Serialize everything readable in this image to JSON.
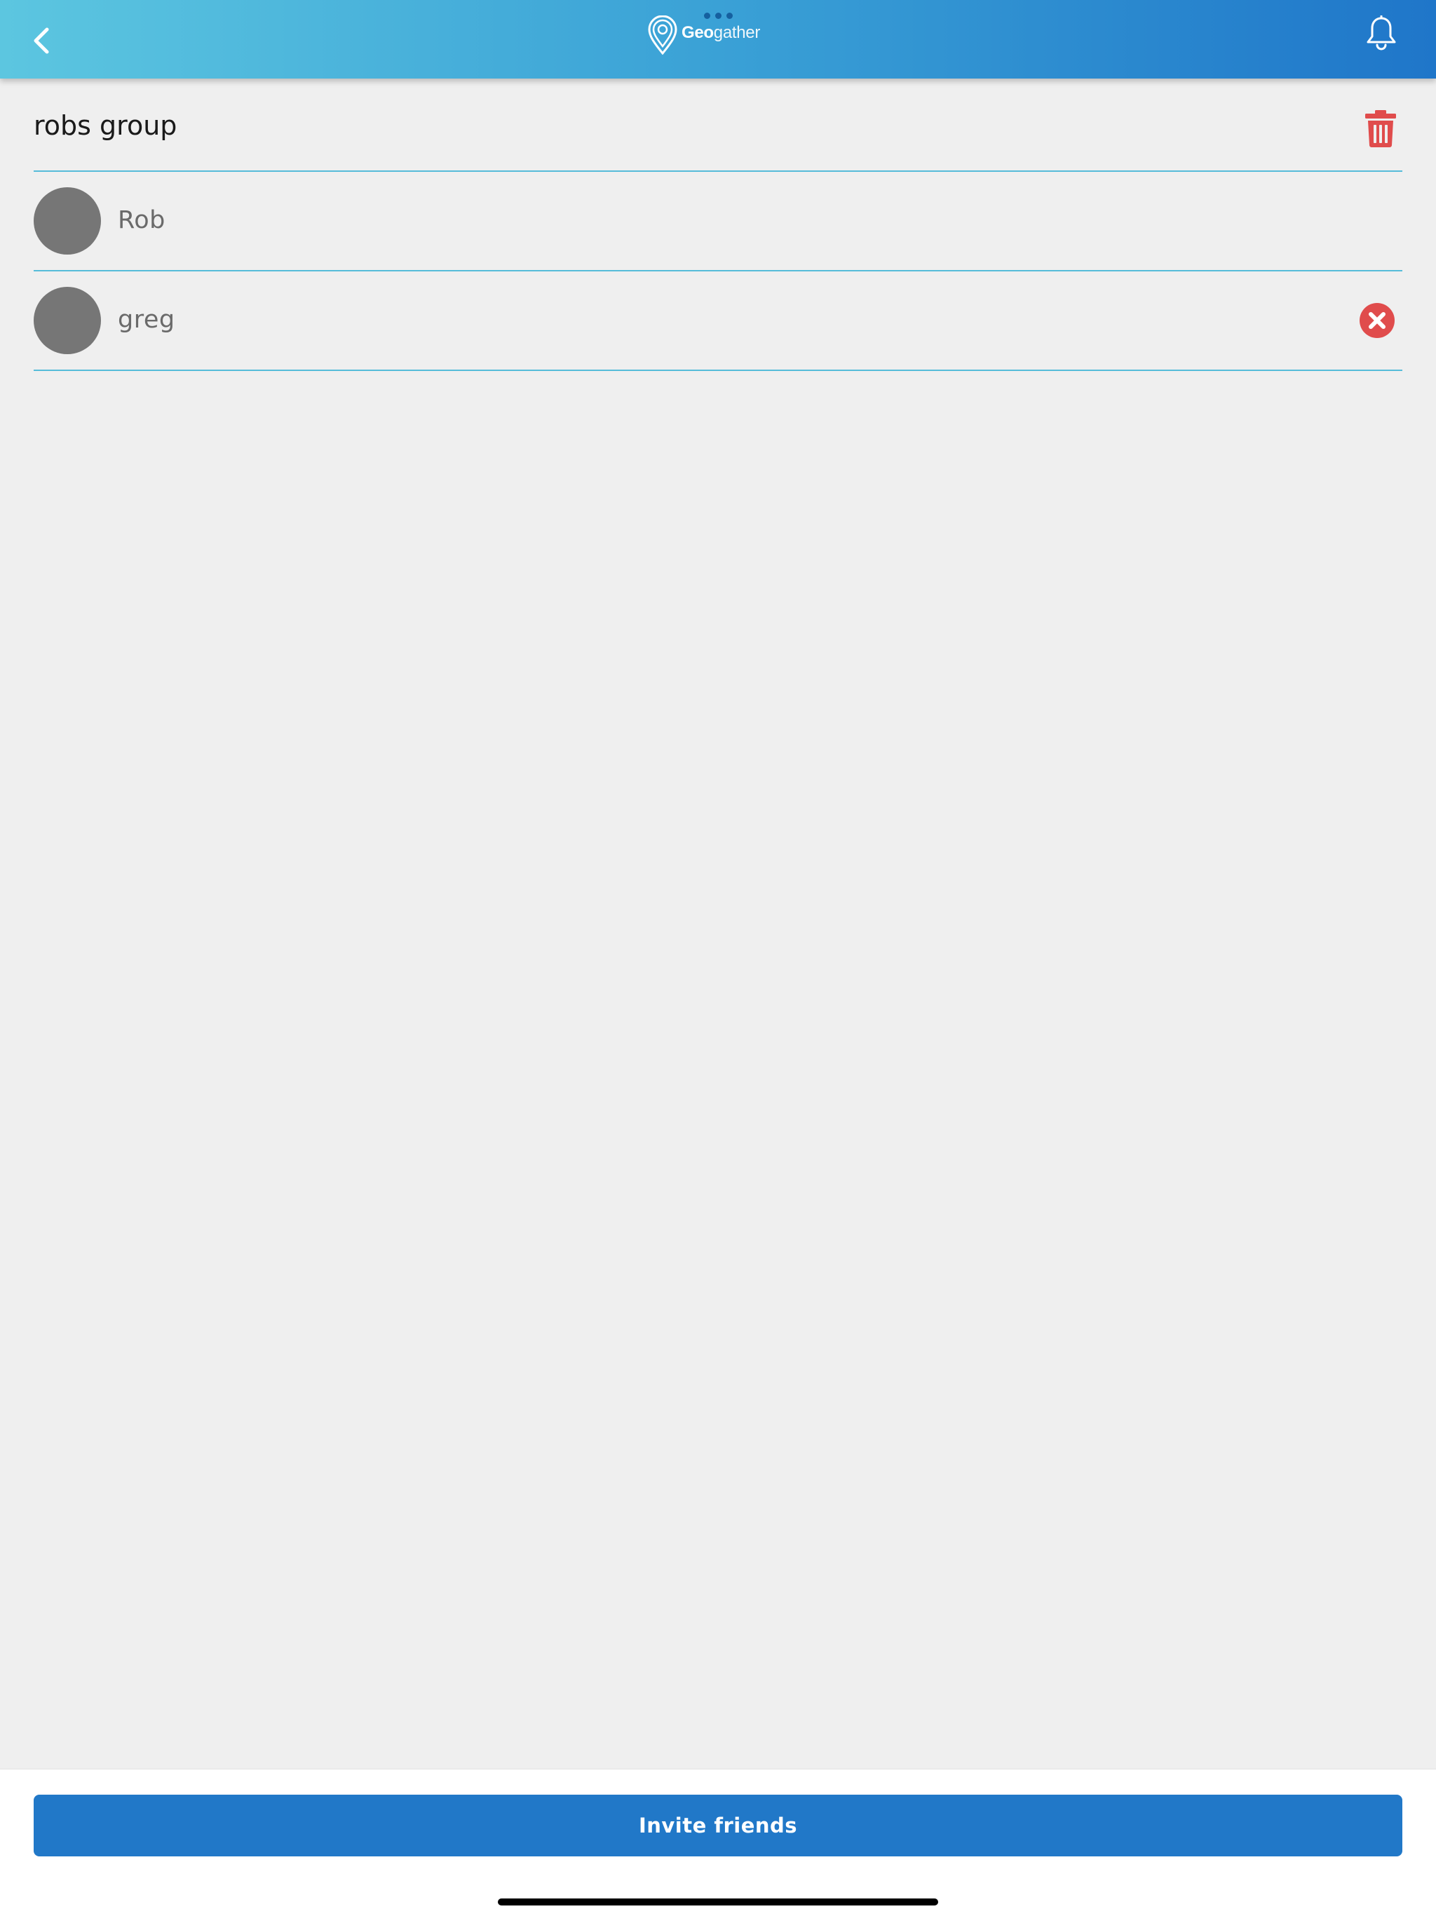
{
  "app": {
    "name_bold": "Geo",
    "name_light": "gather"
  },
  "group": {
    "name": "robs group"
  },
  "members": [
    {
      "name": "Rob",
      "removable": false
    },
    {
      "name": "greg",
      "removable": true
    }
  ],
  "footer": {
    "invite_label": "Invite friends"
  },
  "icons": {
    "back": "chevron-left-icon",
    "notifications": "bell-icon",
    "delete_group": "trash-icon",
    "remove_member": "close-circle-icon",
    "logo": "map-pin-icon"
  },
  "colors": {
    "header_gradient_start": "#5cc6e0",
    "header_gradient_end": "#1f76c9",
    "divider": "#56bcd9",
    "danger": "#e04c4c",
    "primary": "#2178c8",
    "avatar": "#767676"
  }
}
